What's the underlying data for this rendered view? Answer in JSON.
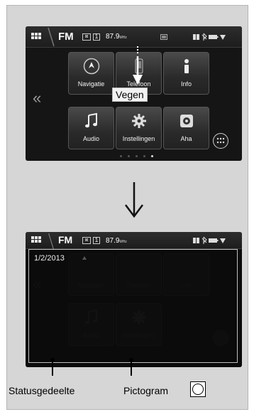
{
  "status_bar": {
    "band": "FM",
    "channel_badge": "⊠",
    "channel_number": "1",
    "frequency": "87.9",
    "frequency_unit": "MHz"
  },
  "home_screen": {
    "tiles_row1": [
      {
        "label": "Navigatie",
        "icon": "navigation-icon"
      },
      {
        "label": "Telefoon",
        "icon": "phone-icon"
      },
      {
        "label": "Info",
        "icon": "info-icon"
      }
    ],
    "tiles_row2": [
      {
        "label": "Audio",
        "icon": "music-note-icon"
      },
      {
        "label": "Instellingen",
        "icon": "settings-gear-icon"
      },
      {
        "label": "Aha",
        "icon": "aha-icon"
      }
    ],
    "swipe_label": "Vegen"
  },
  "status_drawer": {
    "date": "1/2/2013"
  },
  "callouts": {
    "status_area": "Statusgedeelte",
    "icon": "Pictogram"
  }
}
